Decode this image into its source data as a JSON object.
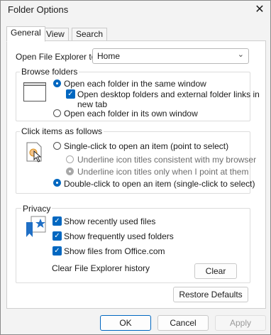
{
  "window": {
    "title": "Folder Options",
    "close_glyph": "✕"
  },
  "tabs": [
    {
      "label": "General"
    },
    {
      "label": "View"
    },
    {
      "label": "Search"
    }
  ],
  "open_explorer": {
    "label": "Open File Explorer to:",
    "value": "Home"
  },
  "browse_folders": {
    "title": "Browse folders",
    "option_same_window": "Open each folder in the same window",
    "open_desktop_line1": "Open desktop folders and external folder links in",
    "open_desktop_line2": "new tab",
    "option_own_window": "Open each folder in its own window"
  },
  "click_items": {
    "title": "Click items as follows",
    "single_click": "Single-click to open an item (point to select)",
    "underline_browser": "Underline icon titles consistent with my browser",
    "underline_point": "Underline icon titles only when I point at them",
    "double_click": "Double-click to open an item (single-click to select)"
  },
  "privacy": {
    "title": "Privacy",
    "recent_files": "Show recently used files",
    "frequent_folders": "Show frequently used folders",
    "office_files": "Show files from Office.com",
    "clear_history": "Clear File Explorer history",
    "clear_button": "Clear"
  },
  "restore_defaults": "Restore Defaults",
  "buttons": {
    "ok": "OK",
    "cancel": "Cancel",
    "apply": "Apply"
  },
  "colors": {
    "accent": "#0067c0"
  }
}
